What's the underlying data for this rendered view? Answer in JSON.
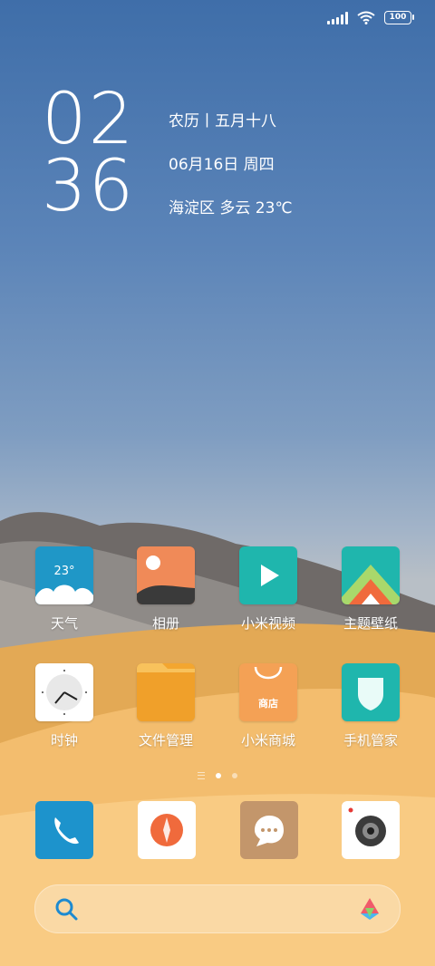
{
  "status_bar": {
    "battery": "100"
  },
  "clock": {
    "hours": "02",
    "minutes": "36"
  },
  "info": {
    "lunar": "农历丨五月十八",
    "date": "06月16日  周四",
    "weather": "海淀区 多云 23℃"
  },
  "apps": {
    "weather": {
      "label": "天气",
      "temp": "23°"
    },
    "gallery": {
      "label": "相册"
    },
    "video": {
      "label": "小米视频"
    },
    "themes": {
      "label": "主题壁纸"
    },
    "clock": {
      "label": "时钟"
    },
    "files": {
      "label": "文件管理"
    },
    "store": {
      "label": "小米商城",
      "badge": "商店"
    },
    "security": {
      "label": "手机管家"
    }
  },
  "dock": [
    "phone-app",
    "browser-app",
    "messages-app",
    "camera-app"
  ],
  "colors": {
    "sky_top": "#3f6ea9",
    "sand": "#f7c67a",
    "weather_blue": "#1f97c7",
    "teal": "#1fb6ad",
    "orange": "#f08a58"
  }
}
